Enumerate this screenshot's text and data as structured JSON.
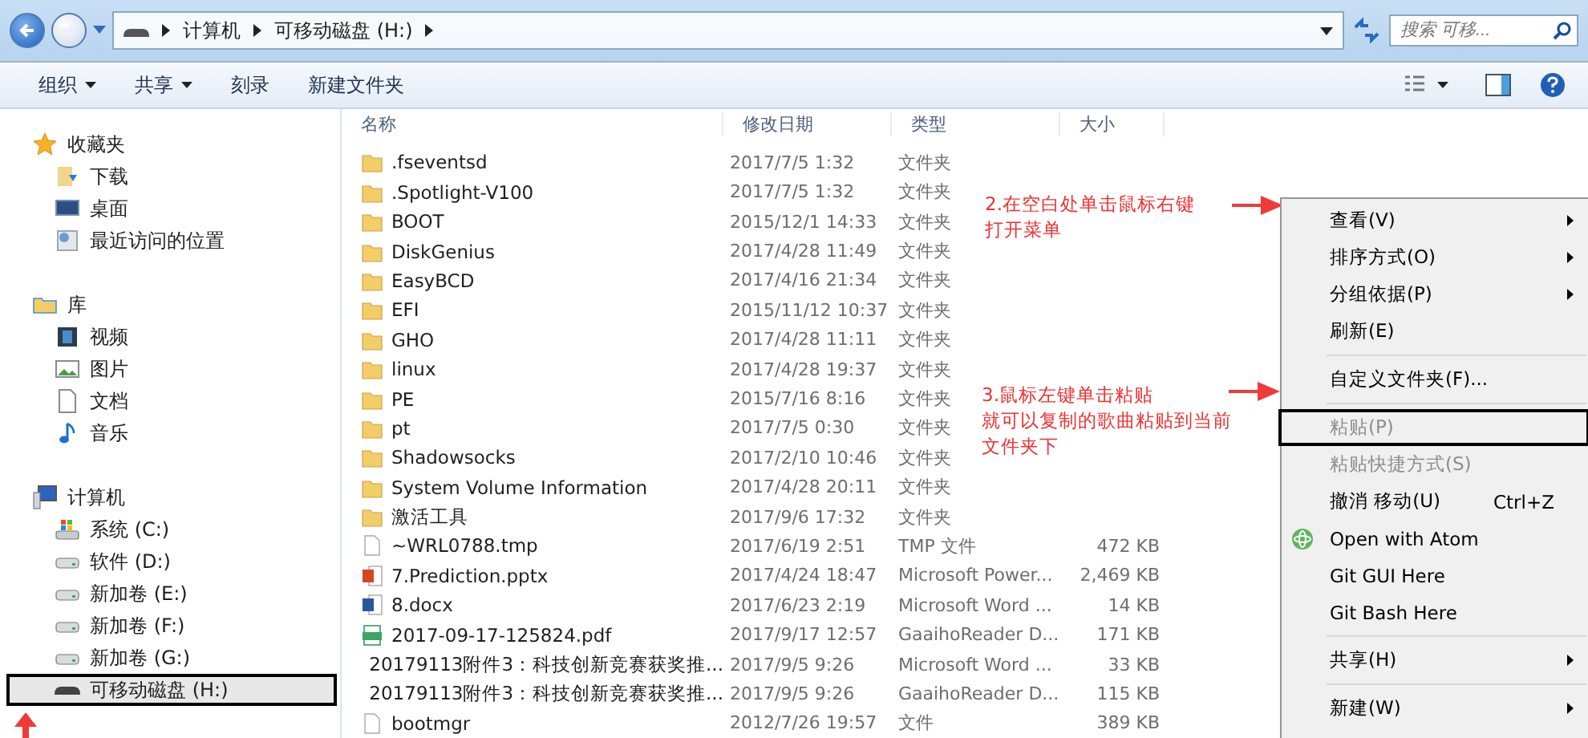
{
  "nav": {
    "address": [
      "计算机",
      "可移动磁盘 (H:)"
    ],
    "search": {
      "placeholder": "搜索 可移..."
    }
  },
  "toolbar": [
    {
      "label": "组织",
      "has_menu": true
    },
    {
      "label": "共享",
      "has_menu": true
    },
    {
      "label": "刻录",
      "has_menu": false
    },
    {
      "label": "新建文件夹",
      "has_menu": false
    }
  ],
  "sidebar": [
    {
      "label": "收藏夹",
      "kind": "star",
      "children": [
        {
          "label": "下载",
          "kind": "download",
          "selected": false,
          "highlighted": false
        },
        {
          "label": "桌面",
          "kind": "desktop",
          "selected": false,
          "highlighted": false
        },
        {
          "label": "最近访问的位置",
          "kind": "recent",
          "selected": false,
          "highlighted": false
        }
      ]
    },
    {
      "label": "库",
      "kind": "library",
      "children": [
        {
          "label": "视频",
          "kind": "video",
          "selected": false,
          "highlighted": false
        },
        {
          "label": "图片",
          "kind": "image",
          "selected": false,
          "highlighted": false
        },
        {
          "label": "文档",
          "kind": "doc",
          "selected": false,
          "highlighted": false
        },
        {
          "label": "音乐",
          "kind": "music",
          "selected": false,
          "highlighted": false
        }
      ]
    },
    {
      "label": "计算机",
      "kind": "computer",
      "children": [
        {
          "label": "系统 (C:)",
          "kind": "sysdrive",
          "selected": false,
          "highlighted": false
        },
        {
          "label": "软件 (D:)",
          "kind": "drive",
          "selected": false,
          "highlighted": false
        },
        {
          "label": "新加卷 (E:)",
          "kind": "drive",
          "selected": false,
          "highlighted": false
        },
        {
          "label": "新加卷 (F:)",
          "kind": "drive",
          "selected": false,
          "highlighted": false
        },
        {
          "label": "新加卷 (G:)",
          "kind": "drive",
          "selected": false,
          "highlighted": false
        },
        {
          "label": "可移动磁盘 (H:)",
          "kind": "removable",
          "selected": true,
          "highlighted": true
        }
      ]
    }
  ],
  "columns": [
    "名称",
    "修改日期",
    "类型",
    "大小"
  ],
  "rows": [
    {
      "kind": "folder",
      "name": ".fseventsd",
      "date": "2017/7/5 1:32",
      "type": "文件夹"
    },
    {
      "kind": "folder",
      "name": ".Spotlight-V100",
      "date": "2017/7/5 1:32",
      "type": "文件夹"
    },
    {
      "kind": "folder",
      "name": "BOOT",
      "date": "2015/12/1 14:33",
      "type": "文件夹"
    },
    {
      "kind": "folder",
      "name": "DiskGenius",
      "date": "2017/4/28 11:49",
      "type": "文件夹"
    },
    {
      "kind": "folder",
      "name": "EasyBCD",
      "date": "2017/4/16 21:34",
      "type": "文件夹"
    },
    {
      "kind": "folder",
      "name": "EFI",
      "date": "2015/11/12 10:37",
      "type": "文件夹"
    },
    {
      "kind": "folder",
      "name": "GHO",
      "date": "2017/4/28 11:11",
      "type": "文件夹"
    },
    {
      "kind": "folder",
      "name": "linux",
      "date": "2017/4/28 19:37",
      "type": "文件夹"
    },
    {
      "kind": "folder",
      "name": "PE",
      "date": "2015/7/16 8:16",
      "type": "文件夹"
    },
    {
      "kind": "folder",
      "name": "pt",
      "date": "2017/7/5 0:30",
      "type": "文件夹"
    },
    {
      "kind": "folder",
      "name": "Shadowsocks",
      "date": "2017/2/10 10:46",
      "type": "文件夹"
    },
    {
      "kind": "folder",
      "name": "System Volume Information",
      "date": "2017/4/28 20:11",
      "type": "文件夹"
    },
    {
      "kind": "folder",
      "name": "激活工具",
      "date": "2017/9/6 17:32",
      "type": "文件夹"
    },
    {
      "kind": "file",
      "name": "~WRL0788.tmp",
      "date": "2017/6/19 2:51",
      "type": "TMP 文件",
      "size": "472 KB"
    },
    {
      "kind": "pptx",
      "name": "7.Prediction.pptx",
      "date": "2017/4/24 18:47",
      "type": "Microsoft Power...",
      "size": "2,469 KB"
    },
    {
      "kind": "docx",
      "name": "8.docx",
      "date": "2017/6/23 2:19",
      "type": "Microsoft Word ...",
      "size": "14 KB"
    },
    {
      "kind": "pdf",
      "name": "2017-09-17-125824.pdf",
      "date": "2017/9/17 12:57",
      "type": "GaaihoReader D...",
      "size": "171 KB"
    },
    {
      "kind": "docx",
      "name": "20179113附件3：科技创新竞赛获奖推...",
      "date": "2017/9/5 9:26",
      "type": "Microsoft Word ...",
      "size": "33 KB"
    },
    {
      "kind": "pdf",
      "name": "20179113附件3：科技创新竞赛获奖推...",
      "date": "2017/9/5 9:26",
      "type": "GaaihoReader D...",
      "size": "115 KB"
    },
    {
      "kind": "file",
      "name": "bootmgr",
      "date": "2012/7/26 19:57",
      "type": "文件",
      "size": "389 KB"
    }
  ],
  "context_menu": [
    {
      "kind": "item",
      "label": "查看(V)",
      "submenu": true,
      "disabled": false,
      "highlighted": false
    },
    {
      "kind": "item",
      "label": "排序方式(O)",
      "submenu": true,
      "disabled": false,
      "highlighted": false
    },
    {
      "kind": "item",
      "label": "分组依据(P)",
      "submenu": true,
      "disabled": false,
      "highlighted": false
    },
    {
      "kind": "item",
      "label": "刷新(E)",
      "submenu": false,
      "disabled": false,
      "highlighted": false
    },
    {
      "kind": "separator"
    },
    {
      "kind": "item",
      "label": "自定义文件夹(F)...",
      "submenu": false,
      "disabled": false,
      "highlighted": false
    },
    {
      "kind": "separator"
    },
    {
      "kind": "item",
      "label": "粘贴(P)",
      "submenu": false,
      "disabled": true,
      "highlighted": true
    },
    {
      "kind": "item",
      "label": "粘贴快捷方式(S)",
      "submenu": false,
      "disabled": true,
      "highlighted": false
    },
    {
      "kind": "item",
      "label": "撤消 移动(U)",
      "shortcut": "Ctrl+Z",
      "submenu": false,
      "disabled": false,
      "highlighted": false
    },
    {
      "kind": "atom_item",
      "label": "Open with Atom",
      "submenu": false,
      "disabled": false,
      "highlighted": false
    },
    {
      "kind": "item",
      "label": "Git GUI Here",
      "submenu": false,
      "disabled": false,
      "highlighted": false
    },
    {
      "kind": "item",
      "label": "Git Bash Here",
      "submenu": false,
      "disabled": false,
      "highlighted": false
    },
    {
      "kind": "separator"
    },
    {
      "kind": "item",
      "label": "共享(H)",
      "submenu": true,
      "disabled": false,
      "highlighted": false
    },
    {
      "kind": "separator"
    },
    {
      "kind": "item",
      "label": "新建(W)",
      "submenu": true,
      "disabled": false,
      "highlighted": false
    }
  ],
  "annotations": [
    {
      "lines": [
        "2.在空白处单击鼠标右键",
        "打开菜单"
      ]
    },
    {
      "lines": [
        "3.鼠标左键单击粘贴",
        "就可以复制的歌曲粘贴到当前",
        "文件夹下"
      ]
    }
  ]
}
